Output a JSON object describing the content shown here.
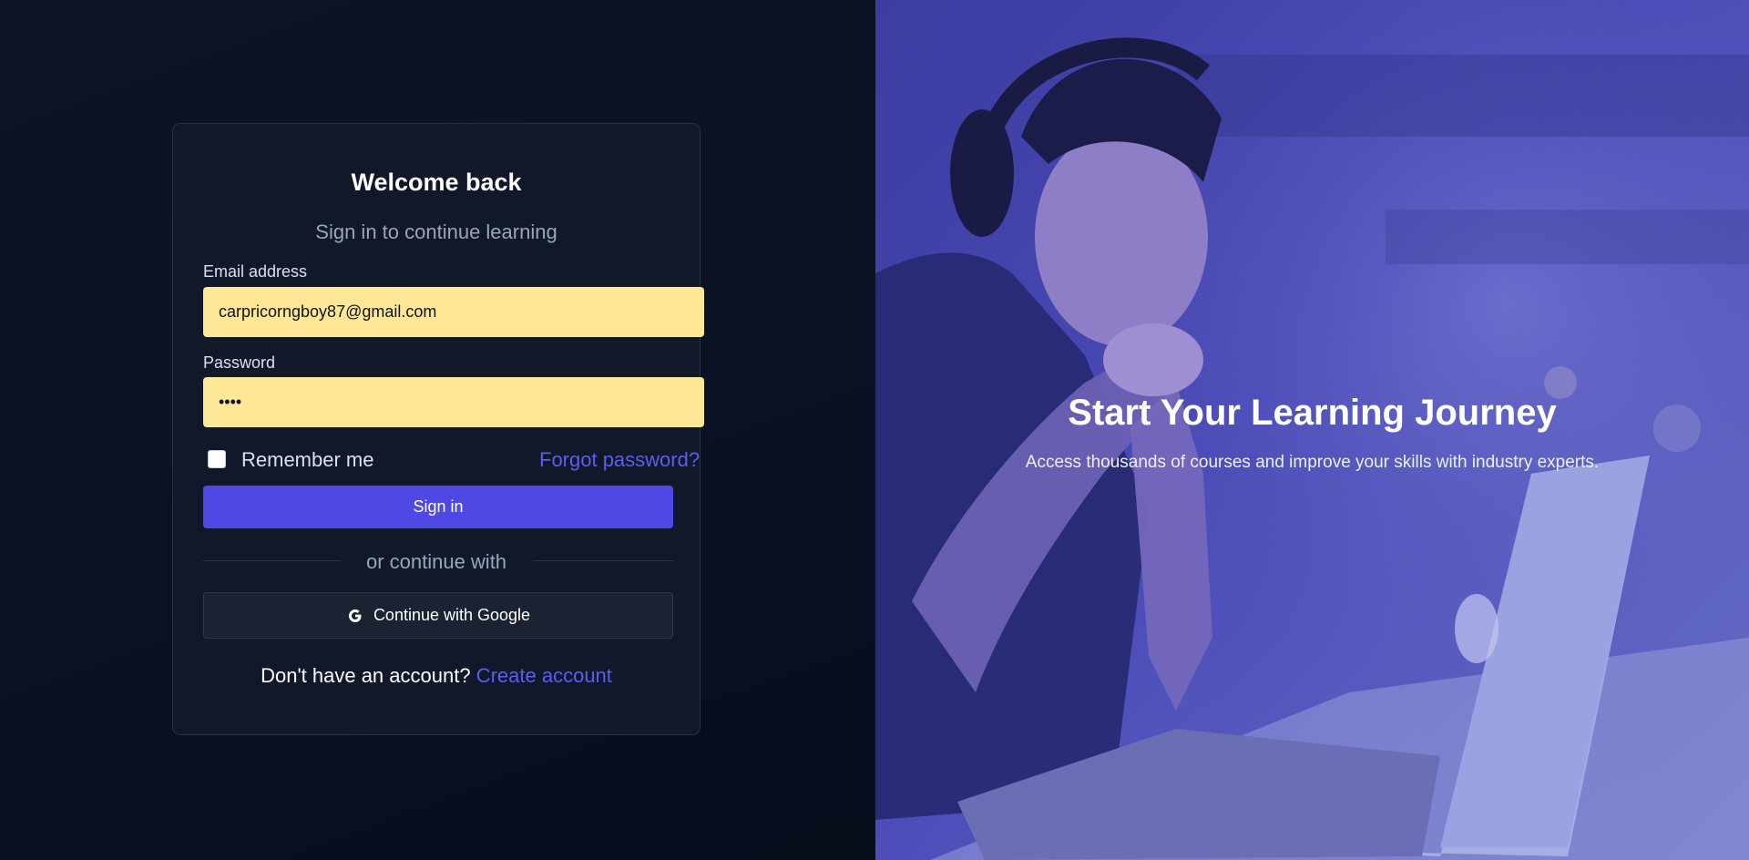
{
  "login": {
    "title": "Welcome back",
    "subtitle": "Sign in to continue learning",
    "email": {
      "label": "Email address",
      "value": "carpricorngboy87@gmail.com"
    },
    "password": {
      "label": "Password",
      "value": "••••"
    },
    "remember_label": "Remember me",
    "remember_checked": false,
    "forgot_link": "Forgot password?",
    "signin_button": "Sign in",
    "divider_text": "or continue with",
    "google_button": "Continue with Google",
    "google_icon": "google-g-icon",
    "footer_text": "Don't have an account?",
    "footer_link": "Create account"
  },
  "hero": {
    "heading": "Start Your Learning Journey",
    "text": "Access thousands of courses and improve your skills with industry experts."
  },
  "colors": {
    "accent": "#5048e5",
    "link": "#5a5ef2",
    "autofill": "#fee898",
    "background": "#0a1020",
    "overlay": "#4a4ab8"
  }
}
